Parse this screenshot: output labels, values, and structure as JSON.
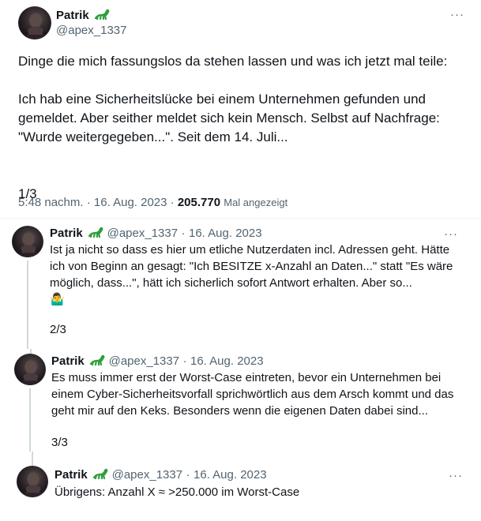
{
  "main_tweet": {
    "name": "Patrik",
    "handle": "@apex_1337",
    "body": "Dinge die mich fassungslos da stehen lassen und was ich jetzt mal teile:\n\nIch hab eine Sicherheitslücke bei einem Unternehmen gefunden und gemeldet. Aber seither meldet sich kein Mensch. Selbst auf Nachfrage: \"Wurde weitergegeben...\". Seit dem 14. Juli...\n\n\n1/3",
    "time": "5:48 nachm.",
    "date": "16. Aug. 2023",
    "views_count": "205.770",
    "views_label": "Mal angezeigt"
  },
  "replies": [
    {
      "name": "Patrik",
      "handle": "@apex_1337",
      "date": "16. Aug. 2023",
      "body": "Ist ja nicht so dass es hier um etliche Nutzerdaten incl. Adressen geht. Hätte ich von Beginn an gesagt: \"Ich BESITZE x-Anzahl an Daten...\" statt \"Es wäre möglich, dass...\", hätt ich sicherlich sofort Antwort erhalten. Aber so...",
      "emoji": "🤷‍♂️",
      "counter": "2/3"
    },
    {
      "name": "Patrik",
      "handle": "@apex_1337",
      "date": "16. Aug. 2023",
      "body": "Es muss immer erst der Worst-Case eintreten, bevor ein Unternehmen bei einem Cyber-Sicherheitsvorfall sprichwörtlich aus dem Arsch kommt und das geht mir auf den Keks. Besonders wenn die eigenen Daten dabei sind...",
      "counter": "3/3"
    },
    {
      "name": "Patrik",
      "handle": "@apex_1337",
      "date": "16. Aug. 2023",
      "body": "Übrigens: Anzahl X ≈ >250.000 im Worst-Case"
    }
  ],
  "separator_dot": "·",
  "more_glyph": "···",
  "colors": {
    "text": "#0f1419",
    "secondary": "#536471",
    "line": "#cfd9de",
    "lizard": "#2e9e3a"
  },
  "icons": [
    "lizard-emoji-icon",
    "more-options-icon",
    "shrug-emoji-icon"
  ]
}
